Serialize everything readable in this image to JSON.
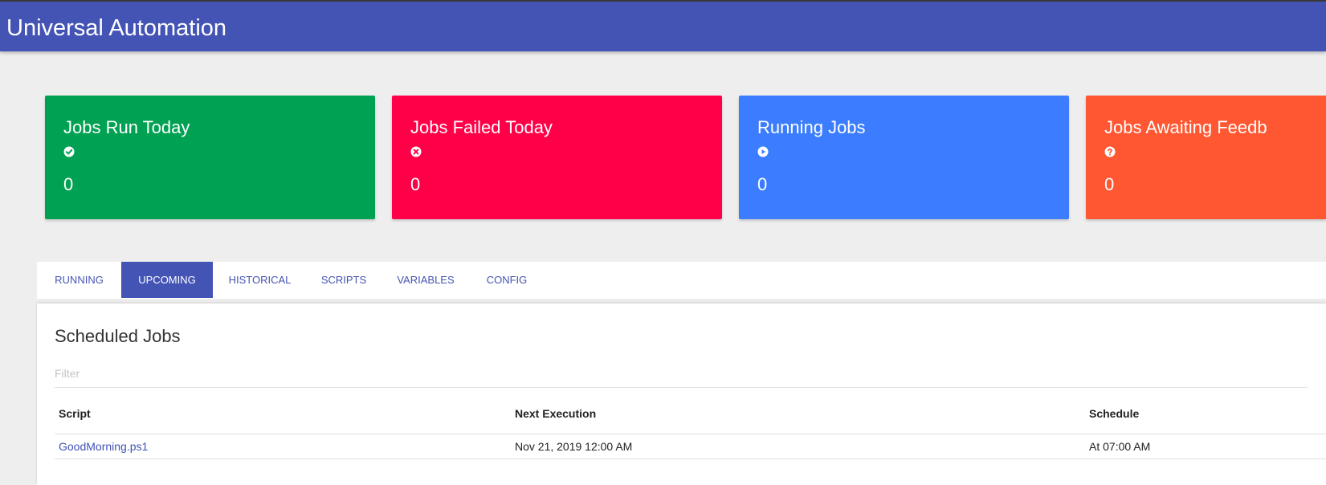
{
  "app": {
    "title": "Universal Automation",
    "colors": {
      "header": "#4454b4",
      "accent": "#4454b4"
    }
  },
  "cards": [
    {
      "title": "Jobs Run Today",
      "icon": "check-circle-icon",
      "value": "0",
      "color": "#00a152"
    },
    {
      "title": "Jobs Failed Today",
      "icon": "times-circle-icon",
      "value": "0",
      "color": "#ff0048"
    },
    {
      "title": "Running Jobs",
      "icon": "play-circle-icon",
      "value": "0",
      "color": "#3c7dff"
    },
    {
      "title": "Jobs Awaiting Feedb",
      "icon": "question-circle-icon",
      "value": "0",
      "color": "#ff5731"
    }
  ],
  "tabs": [
    {
      "label": "Running",
      "active": false
    },
    {
      "label": "Upcoming",
      "active": true
    },
    {
      "label": "Historical",
      "active": false
    },
    {
      "label": "Scripts",
      "active": false
    },
    {
      "label": "Variables",
      "active": false
    },
    {
      "label": "Config",
      "active": false
    }
  ],
  "panel": {
    "title": "Scheduled Jobs",
    "filter_placeholder": "Filter",
    "columns": [
      "Script",
      "Next Execution",
      "Schedule"
    ],
    "rows": [
      {
        "script": "GoodMorning.ps1",
        "next_execution": "Nov 21, 2019 12:00 AM",
        "schedule": "At 07:00 AM"
      }
    ]
  }
}
